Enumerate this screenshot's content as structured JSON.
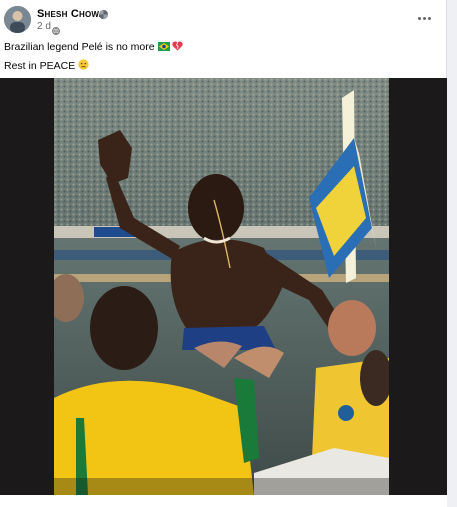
{
  "post": {
    "author": "Shesh Chowa",
    "timestamp": "2 d",
    "caption_line1": "Brazilian legend Pelé is no more",
    "caption_line2": "Rest in PEACE"
  },
  "icons": {
    "author_badge": "pinwheel-icon",
    "privacy": "globe-icon",
    "more": "more-options-icon",
    "flag": "brazil-flag-emoji",
    "heart": "broken-heart-emoji",
    "sad": "sad-face-emoji"
  },
  "colors": {
    "shirt_yellow": "#f2c515",
    "shirt_green": "#1a7a3a",
    "crowd": "#5f6e6e",
    "media_bg": "#1b1919"
  }
}
